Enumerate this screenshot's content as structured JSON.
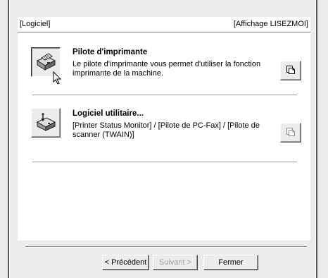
{
  "header": {
    "left_label": "[Logiciel]",
    "right_label": "[Affichage LISEZMOI]"
  },
  "items": [
    {
      "title": "Pilote d'imprimante",
      "description_line1": "Le pilote d'imprimante vous permet d'utiliser la fonction",
      "description_line2": "imprimante de la machine.",
      "icon": "printer-icon",
      "doc_icon": "readme-document-icon"
    },
    {
      "title": "Logiciel utilitaire...",
      "description_line1": "[Printer Status Monitor] / [Pilote de PC-Fax] / [Pilote de",
      "description_line2": "scanner (TWAIN)]",
      "icon": "utility-software-icon",
      "doc_icon": "readme-document-icon"
    }
  ],
  "buttons": {
    "back": "< Précédent",
    "next": "Suivant >",
    "close": "Fermer"
  }
}
